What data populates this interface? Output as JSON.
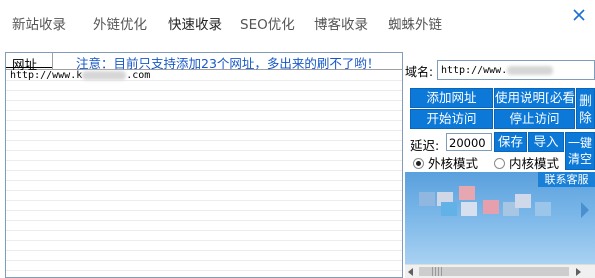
{
  "tabs": [
    {
      "label": "新站收录",
      "active": false
    },
    {
      "label": "外链优化",
      "active": false
    },
    {
      "label": "快速收录",
      "active": true
    },
    {
      "label": "SEO优化",
      "active": false
    },
    {
      "label": "博客收录",
      "active": false
    },
    {
      "label": "蜘蛛外链",
      "active": false
    }
  ],
  "list": {
    "column_header": "网址",
    "notice": "注意：目前只支持添加23个网址，多出来的刷不了哟！",
    "rows": [
      {
        "url_prefix": "http://www.k",
        "url_suffix": ".com"
      }
    ]
  },
  "panel": {
    "domain_label": "域名:",
    "domain_prefix": "http://www.",
    "add_url_button": "添加网址",
    "help_button": "使用说明[必看]",
    "delete_button": "删除",
    "start_button": "开始访问",
    "stop_button": "停止访问",
    "delay_label": "延迟:",
    "delay_value": "20000",
    "save_button": "保存",
    "import_button": "导入",
    "clear_button": "一键清空",
    "mode_external": "外核模式",
    "mode_internal": "内核模式",
    "selected_mode": "external"
  },
  "ad": {
    "contact_button": "联系客服"
  },
  "colors": {
    "accent": "#0c79d8",
    "notice_text": "#1557c7"
  }
}
